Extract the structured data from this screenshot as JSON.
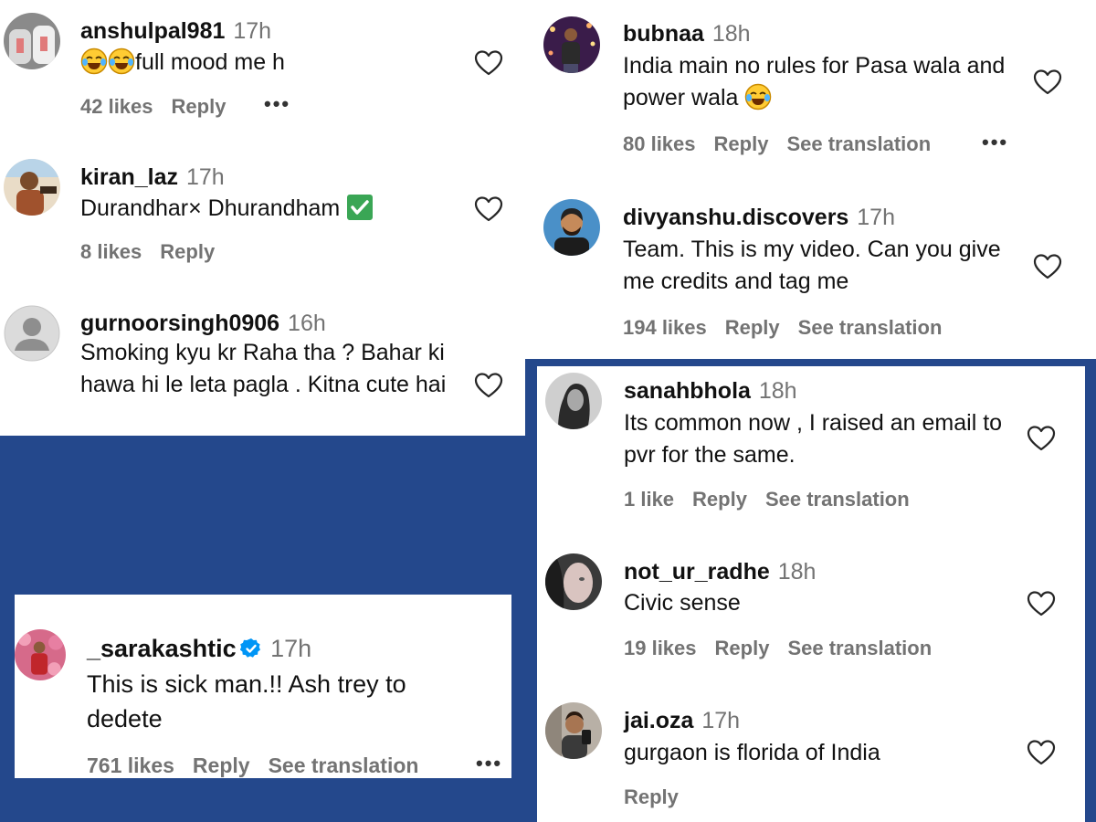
{
  "comments": {
    "anshulpal": {
      "username": "anshulpal981",
      "time": "17h",
      "text_emojis": [
        "laughing-tears-emoji",
        "laughing-tears-emoji"
      ],
      "text": "full mood me h",
      "likes": "42 likes",
      "reply": "Reply",
      "more": "•••"
    },
    "kiran": {
      "username": "kiran_laz",
      "time": "17h",
      "text": "Durandhar× Dhurandham",
      "text_emoji": "green-check-emoji",
      "likes": "8 likes",
      "reply": "Reply"
    },
    "gurnoor": {
      "username": "gurnoorsingh0906",
      "time": "16h",
      "text": "Smoking kyu kr Raha tha ? Bahar ki hawa hi le leta pagla . Kitna cute hai"
    },
    "bubnaa": {
      "username": "bubnaa",
      "time": "18h",
      "text": "India main no rules for Pasa wala and power wala",
      "text_emoji": "laughing-tears-emoji",
      "likes": "80 likes",
      "reply": "Reply",
      "translation": "See translation",
      "more": "•••"
    },
    "divyanshu": {
      "username": "divyanshu.discovers",
      "time": "17h",
      "text": "Team. This is my video. Can you give me credits and tag me",
      "likes": "194 likes",
      "reply": "Reply",
      "translation": "See translation"
    },
    "sarakashtic": {
      "username": "_sarakashtic",
      "verified": true,
      "time": "17h",
      "text": "This is sick man.!! Ash trey to dedete",
      "likes": "761 likes",
      "reply": "Reply",
      "translation": "See translation",
      "more": "•••"
    },
    "sanahbhola": {
      "username": "sanahbhola",
      "time": "18h",
      "text": "Its common now , I raised an email to pvr for the same.",
      "likes": "1 like",
      "reply": "Reply",
      "translation": "See translation"
    },
    "radhe": {
      "username": "not_ur_radhe",
      "time": "18h",
      "text": "Civic sense",
      "likes": "19 likes",
      "reply": "Reply",
      "translation": "See translation"
    },
    "jaioza": {
      "username": "jai.oza",
      "time": "17h",
      "text": "gurgaon is florida of India",
      "reply": "Reply"
    }
  },
  "colors": {
    "background": "#24488c",
    "panel": "#ffffff",
    "muted_text": "#737373",
    "verified_blue": "#0095f6"
  },
  "icons": {
    "like": "heart-outline-icon",
    "verified": "verified-badge-icon",
    "more": "more-dots-icon"
  }
}
